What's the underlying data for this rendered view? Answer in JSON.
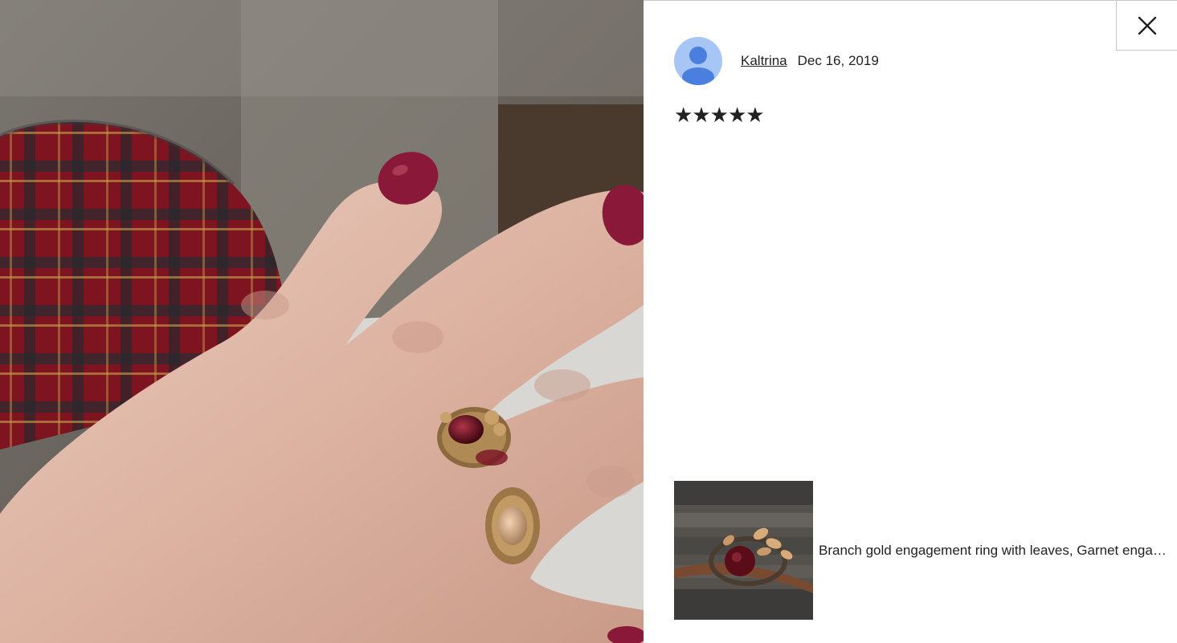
{
  "review": {
    "reviewer_name": "Kaltrina",
    "date": "Dec 16, 2019",
    "rating": 5,
    "rating_max": 5,
    "star_glyph": "★"
  },
  "listing": {
    "title": "Branch gold engagement ring with leaves, Garnet engagement ring, Leaves ring"
  },
  "icons": {
    "close": "close-icon",
    "avatar": "user-avatar-icon"
  },
  "colors": {
    "avatar_bg": "#a7c5f5",
    "avatar_figure": "#4a7fe0",
    "nail_polish": "#8a1838",
    "garnet": "#6a0f1f",
    "gold": "#b08a55"
  }
}
